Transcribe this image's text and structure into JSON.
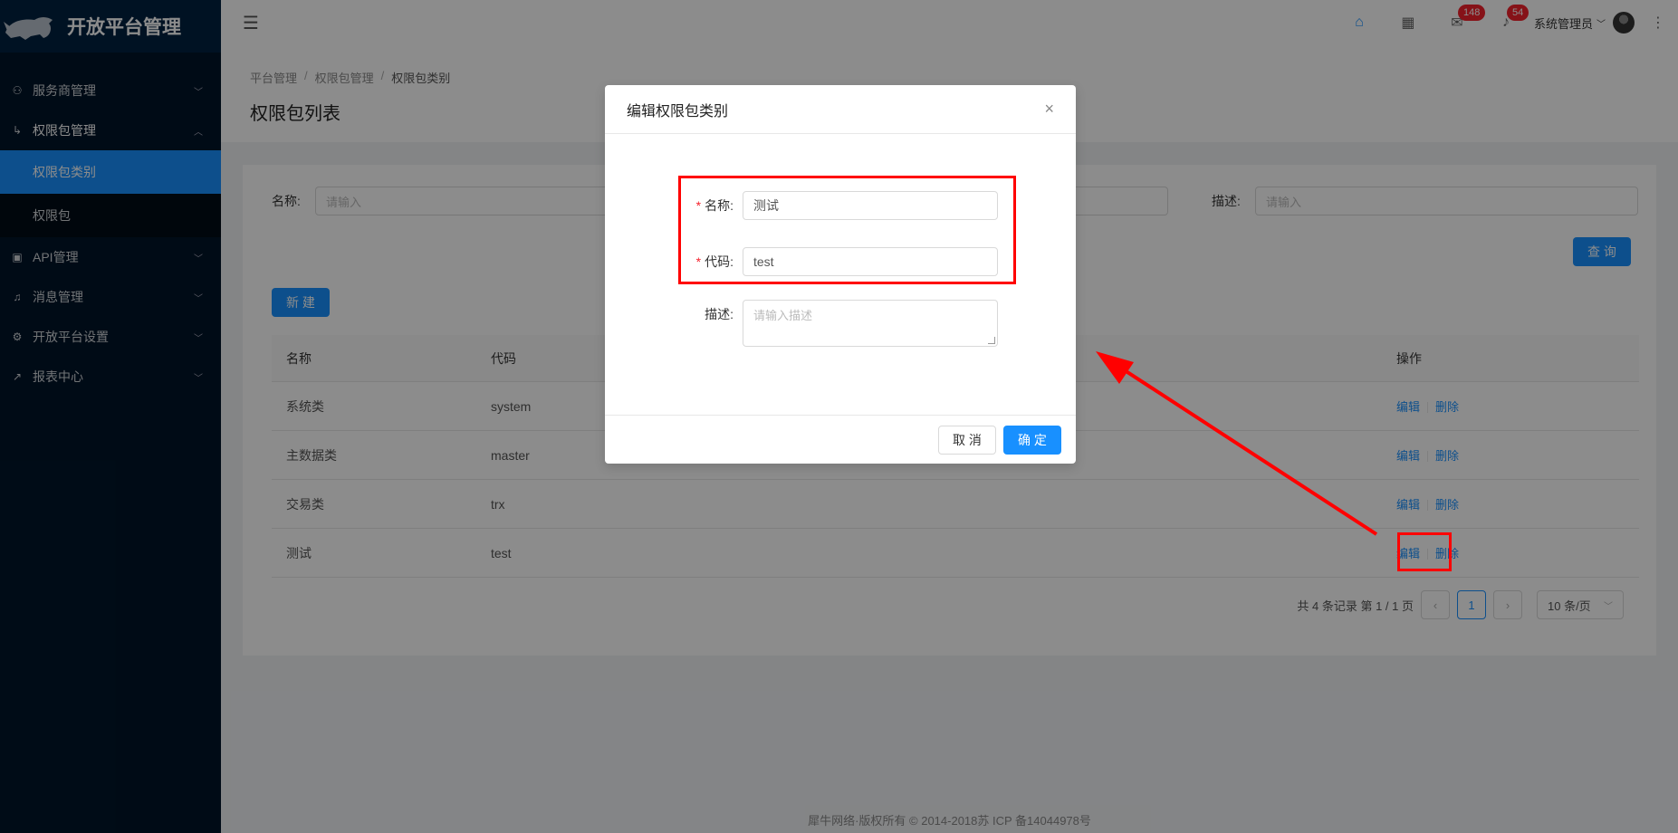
{
  "app": {
    "title": "开放平台管理"
  },
  "sidebar": {
    "items": [
      {
        "label": "服务商管理",
        "icon": "team-icon"
      },
      {
        "label": "权限包管理",
        "icon": "permission-icon",
        "expanded": true,
        "children": [
          {
            "label": "权限包类别",
            "active": true
          },
          {
            "label": "权限包"
          }
        ]
      },
      {
        "label": "API管理",
        "icon": "api-icon"
      },
      {
        "label": "消息管理",
        "icon": "bell-icon"
      },
      {
        "label": "开放平台设置",
        "icon": "gear-icon"
      },
      {
        "label": "报表中心",
        "icon": "chart-icon"
      }
    ]
  },
  "header": {
    "mail_badge": "148",
    "notify_badge": "54",
    "user_name": "系统管理员"
  },
  "breadcrumb": [
    "平台管理",
    "权限包管理",
    "权限包类别"
  ],
  "page_title": "权限包列表",
  "filter": {
    "name_label": "名称:",
    "name_placeholder": "请输入",
    "desc_label": "描述:",
    "desc_placeholder": "请输入",
    "query_button": "查 询"
  },
  "new_button": "新 建",
  "table": {
    "headers": {
      "name": "名称",
      "code": "代码",
      "ops": "操作"
    },
    "rows": [
      {
        "name": "系统类",
        "code": "system"
      },
      {
        "name": "主数据类",
        "code": "master"
      },
      {
        "name": "交易类",
        "code": "trx"
      },
      {
        "name": "测试",
        "code": "test"
      }
    ],
    "edit_label": "编辑",
    "delete_label": "删除"
  },
  "pagination": {
    "summary": "共 4 条记录 第 1 / 1 页",
    "prev": "‹",
    "current": "1",
    "next": "›",
    "page_size": "10 条/页"
  },
  "footer": "犀牛网络·版权所有 © 2014-2018苏 ICP 备14044978号",
  "modal": {
    "title": "编辑权限包类别",
    "close": "×",
    "name_label": "名称:",
    "name_value": "测试",
    "code_label": "代码:",
    "code_value": "test",
    "desc_label": "描述:",
    "desc_placeholder": "请输入描述",
    "required_mark": "*",
    "cancel": "取 消",
    "ok": "确 定"
  },
  "colors": {
    "primary": "#1890ff",
    "sidebar": "#001529",
    "annotation": "#ff0000"
  }
}
